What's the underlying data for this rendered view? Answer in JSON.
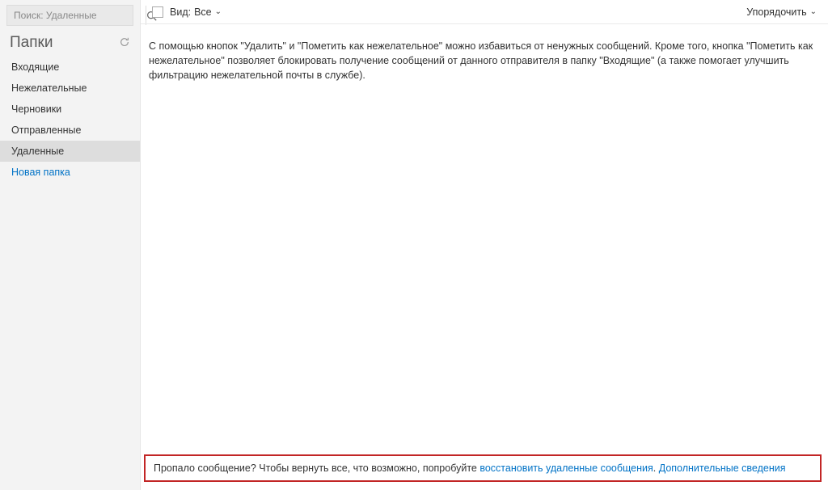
{
  "sidebar": {
    "search_placeholder": "Поиск: Удаленные",
    "title": "Папки",
    "folders": [
      {
        "label": "Входящие",
        "selected": false
      },
      {
        "label": "Нежелательные",
        "selected": false
      },
      {
        "label": "Черновики",
        "selected": false
      },
      {
        "label": "Отправленные",
        "selected": false
      },
      {
        "label": "Удаленные",
        "selected": true
      }
    ],
    "new_folder_label": "Новая папка"
  },
  "toolbar": {
    "view_label": "Вид:",
    "view_value": "Все",
    "sort_label": "Упорядочить"
  },
  "main": {
    "help_text": "С помощью кнопок \"Удалить\" и \"Пометить как нежелательное\" можно избавиться от ненужных сообщений. Кроме того, кнопка \"Пометить как нежелательное\" позволяет блокировать получение сообщений от данного отправителя в папку \"Входящие\" (а также помогает улучшить фильтрацию нежелательной почты в службе)."
  },
  "footer": {
    "prefix": "Пропало сообщение? Чтобы вернуть все, что возможно, попробуйте ",
    "link_recover": "восстановить удаленные сообщения",
    "period": ". ",
    "link_more": "Дополнительные сведения"
  }
}
